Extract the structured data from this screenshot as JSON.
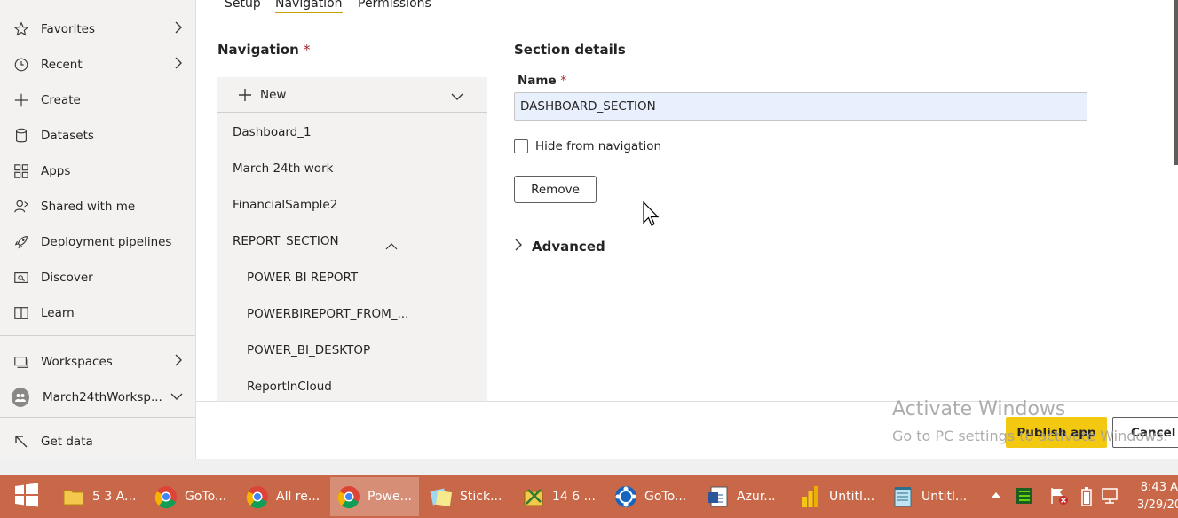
{
  "colors": {
    "accent": "#f2c811",
    "taskbar": "#c96848",
    "nav_bg": "#f3f2f1",
    "input_bg": "#e8f0fe"
  },
  "leftnav": {
    "items": [
      {
        "label": "Favorites",
        "icon": "star-icon",
        "has_chevron": true
      },
      {
        "label": "Recent",
        "icon": "clock-icon",
        "has_chevron": true
      },
      {
        "label": "Create",
        "icon": "plus-icon",
        "has_chevron": false
      },
      {
        "label": "Datasets",
        "icon": "database-icon",
        "has_chevron": false
      },
      {
        "label": "Apps",
        "icon": "apps-icon",
        "has_chevron": false
      },
      {
        "label": "Shared with me",
        "icon": "shared-icon",
        "has_chevron": false
      },
      {
        "label": "Deployment pipelines",
        "icon": "rocket-icon",
        "has_chevron": false
      },
      {
        "label": "Discover",
        "icon": "discover-icon",
        "has_chevron": false
      },
      {
        "label": "Learn",
        "icon": "book-icon",
        "has_chevron": false
      }
    ],
    "workspaces": "Workspaces",
    "current_workspace": "March24thWorksp...",
    "get_data": "Get data"
  },
  "tabs": [
    "Setup",
    "Navigation",
    "Permissions"
  ],
  "navigation": {
    "title": "Navigation",
    "required_mark": "*",
    "new_label": "New",
    "items": [
      "Dashboard_1",
      "March 24th work",
      "FinancialSample2"
    ],
    "section": "REPORT_SECTION",
    "section_children": [
      "POWER BI REPORT",
      "POWERBIREPORT_FROM_...",
      "POWER_BI_DESKTOP",
      "ReportInCloud"
    ]
  },
  "details": {
    "title": "Section details",
    "name_label": "Name",
    "required_mark": "*",
    "name_value": "DASHBOARD_SECTION",
    "hide_label": "Hide from navigation",
    "hide_checked": false,
    "remove_label": "Remove",
    "advanced_label": "Advanced"
  },
  "footer": {
    "publish_label": "Publish app",
    "cancel_label": "Cancel",
    "watermark_title": "Activate Windows",
    "watermark_sub": "Go to PC settings to activate Windows."
  },
  "taskbar": {
    "items": [
      {
        "label": "5 3 A...",
        "icon": "folder-icon"
      },
      {
        "label": "GoTo...",
        "icon": "chrome-icon"
      },
      {
        "label": "All re...",
        "icon": "chrome-icon"
      },
      {
        "label": "Powe...",
        "icon": "chrome-icon",
        "active": true
      },
      {
        "label": "Stick...",
        "icon": "sticky-notes-icon"
      },
      {
        "label": "14 6 ...",
        "icon": "tools-icon"
      },
      {
        "label": "GoTo...",
        "icon": "goto-icon"
      },
      {
        "label": "Azur...",
        "icon": "word-doc-icon"
      },
      {
        "label": "Untitl...",
        "icon": "powerbi-icon"
      },
      {
        "label": "Untitl...",
        "icon": "notepad-icon"
      }
    ],
    "time": "8:43 A",
    "date": "3/29/20"
  }
}
